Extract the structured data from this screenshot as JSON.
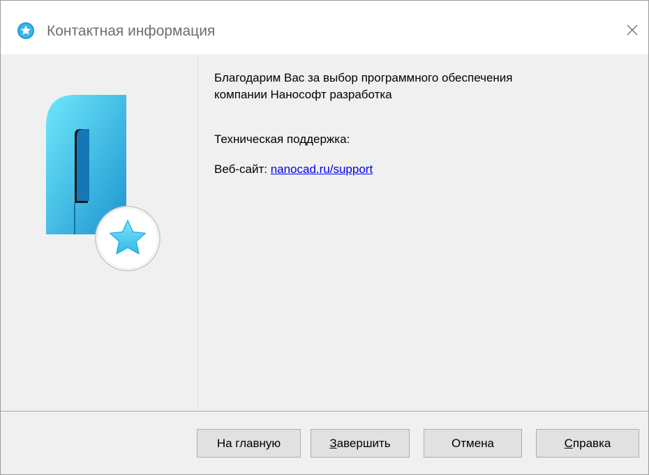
{
  "window": {
    "title": "Контактная информация",
    "close_icon": "close-icon",
    "title_icon": "star-badge-icon"
  },
  "content": {
    "thanks_line1": "Благодарим Вас за выбор программного обеспечения",
    "thanks_line2": "компании Нанософт разработка",
    "support_heading": "Техническая поддержка:",
    "website_label": "Веб-сайт: ",
    "website_link": "nanocad.ru/support"
  },
  "buttons": {
    "home": "На главную",
    "finish_mnemonic": "З",
    "finish_rest": "авершить",
    "cancel": "Отмена",
    "help_mnemonic": "С",
    "help_rest": "правка"
  },
  "colors": {
    "accent_cyan": "#4fd8f5",
    "link": "#0000ee",
    "dialog_bg": "#f0f0f0"
  }
}
